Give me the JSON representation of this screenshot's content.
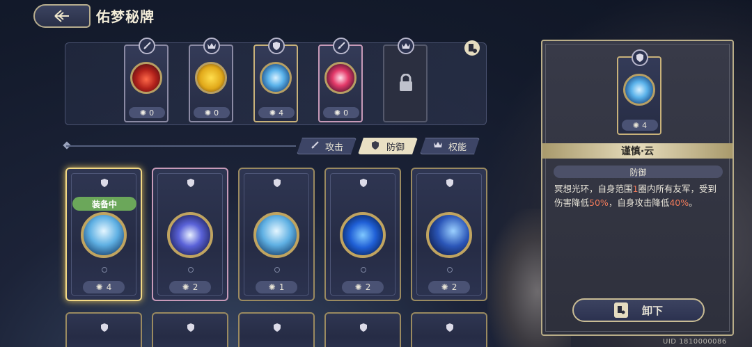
{
  "header": {
    "title": "佑梦秘牌"
  },
  "equipped_slots": [
    {
      "type": "sword-icon",
      "orb": "red",
      "level": "0",
      "border": "gray"
    },
    {
      "type": "crown-icon",
      "orb": "yellow",
      "level": "0",
      "border": "gray"
    },
    {
      "type": "shield-icon",
      "orb": "blue",
      "level": "4",
      "border": "gold"
    },
    {
      "type": "sword-icon",
      "orb": "pink",
      "level": "0",
      "border": "pink"
    },
    {
      "type": "crown-icon",
      "orb": "locked",
      "level": "",
      "border": "locked"
    }
  ],
  "tabs": [
    {
      "label": "攻击",
      "icon": "sword-icon",
      "active": false
    },
    {
      "label": "防御",
      "icon": "shield-icon",
      "active": true
    },
    {
      "label": "权能",
      "icon": "crown-icon",
      "active": false
    }
  ],
  "cards": [
    {
      "orb": "sky",
      "level": "4",
      "equipped_label": "装备中",
      "selected": true,
      "border": "gold"
    },
    {
      "orb": "violet",
      "level": "2",
      "selected": false,
      "border": "pink"
    },
    {
      "orb": "sky",
      "level": "1",
      "selected": false,
      "border": "gold"
    },
    {
      "orb": "deep",
      "level": "2",
      "selected": false,
      "border": "gold"
    },
    {
      "orb": "navy",
      "level": "2",
      "selected": false,
      "border": "gold"
    }
  ],
  "detail": {
    "level": "4",
    "name": "谨慎·云",
    "type": "防御",
    "desc_parts": [
      "冥想光环，自身范围",
      "1",
      "圈内所有友军，受到伤害降低",
      "50%",
      "，自身攻击降低",
      "40%",
      "。"
    ],
    "unequip_label": "卸下"
  },
  "uid": "UID 1810000086",
  "colors": {
    "accent_gold": "#c9b27a",
    "highlight": "#f07a5a",
    "equipped_green": "#6ba75a"
  }
}
